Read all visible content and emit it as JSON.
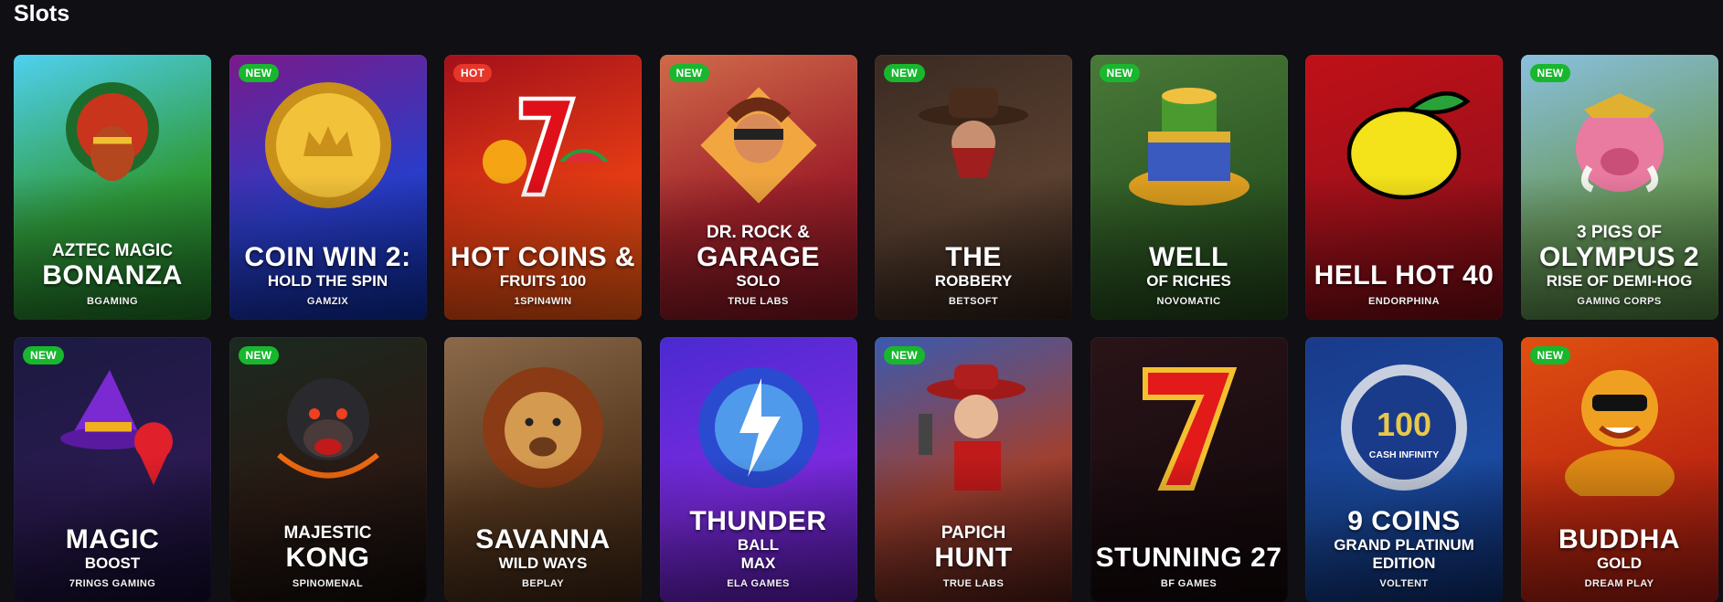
{
  "section": {
    "title": "Slots"
  },
  "games": [
    {
      "t1": "Aztec Magic",
      "t2": "Bonanza",
      "t3": "",
      "provider": "BGAMING",
      "badge": "",
      "badge_type": "",
      "bg": "linear-gradient(160deg,#4fd0f0 0%,#2f9b3a 55%,#1e6d24 100%)",
      "icon": "aztec-chief-icon"
    },
    {
      "t1": "",
      "t2": "Coin Win 2:",
      "t3": "Hold the Spin",
      "provider": "GAMZIX",
      "badge": "NEW",
      "badge_type": "new",
      "bg": "linear-gradient(160deg,#7a1a8a 0%,#2a3cc8 55%,#0a2a9a 100%)",
      "icon": "gold-coin-icon"
    },
    {
      "t1": "",
      "t2": "Hot Coins &",
      "t3": "Fruits 100",
      "provider": "1SPIN4WIN",
      "badge": "HOT",
      "badge_type": "hot",
      "bg": "linear-gradient(160deg,#a3101a 0%,#e23a14 55%,#f05a10 100%)",
      "icon": "seven-fruits-icon"
    },
    {
      "t1": "Dr. Rock &",
      "t2": "Garage",
      "t3": "Solo",
      "provider": "TRUE LABS",
      "badge": "NEW",
      "badge_type": "new",
      "bg": "linear-gradient(160deg,#d06a4a 0%,#a0222a 55%,#7a1420 100%)",
      "icon": "rocker-icon"
    },
    {
      "t1": "",
      "t2": "The",
      "t3": "Robbery",
      "provider": "BETSOFT",
      "badge": "NEW",
      "badge_type": "new",
      "bg": "linear-gradient(160deg,#3a2a22 0%,#5a4030 55%,#2a1c16 100%)",
      "icon": "cowboy-bandit-icon"
    },
    {
      "t1": "",
      "t2": "Well",
      "t3": "of Riches",
      "provider": "NOVOMATIC",
      "badge": "NEW",
      "badge_type": "new",
      "bg": "linear-gradient(160deg,#4a7a3a 0%,#2f5a24 55%,#1e3e18 100%)",
      "icon": "treasure-well-icon"
    },
    {
      "t1": "",
      "t2": "Hell Hot 40",
      "t3": "",
      "provider": "ENDORPHINA",
      "badge": "",
      "badge_type": "",
      "bg": "linear-gradient(160deg,#c01018 0%,#a0101a 55%,#700a12 100%)",
      "icon": "lemon-icon"
    },
    {
      "t1": "3 Pigs of",
      "t2": "Olympus 2",
      "t3": "Rise of Demi-Hog",
      "provider": "GAMING CORPS",
      "badge": "NEW",
      "badge_type": "new",
      "bg": "linear-gradient(160deg,#8ac0e0 0%,#6a9a60 55%,#4a7a3a 100%)",
      "icon": "pig-warrior-icon"
    },
    {
      "t1": "",
      "t2": "Magic",
      "t3": "Boost",
      "provider": "7RINGS GAMING",
      "badge": "NEW",
      "badge_type": "new",
      "bg": "linear-gradient(160deg,#1a1a40 0%,#2a1a50 55%,#120a2a 100%)",
      "icon": "wizard-hat-icon"
    },
    {
      "t1": "Majestic",
      "t2": "Kong",
      "t3": "",
      "provider": "SPINOMENAL",
      "badge": "NEW",
      "badge_type": "new",
      "bg": "linear-gradient(160deg,#1a2a20 0%,#2a1a14 55%,#120c0a 100%)",
      "icon": "gorilla-icon"
    },
    {
      "t1": "",
      "t2": "Savanna",
      "t3": "Wild Ways",
      "provider": "BEPLAY",
      "badge": "",
      "badge_type": "",
      "bg": "linear-gradient(160deg,#8a6a4a 0%,#5a3a20 55%,#3a2414 100%)",
      "icon": "lion-icon"
    },
    {
      "t1": "",
      "t2": "Thunder",
      "t3": "Ball",
      "provider": "ELA GAMES",
      "badge": "",
      "badge_type": "",
      "bg": "linear-gradient(160deg,#4a2ad0 0%,#7a2ae0 55%,#5a1ab0 100%)",
      "icon": "thunder-ball-icon",
      "t4": "Max"
    },
    {
      "t1": "Papich",
      "t2": "Hunt",
      "t3": "",
      "provider": "TRUE LABS",
      "badge": "NEW",
      "badge_type": "new",
      "bg": "linear-gradient(160deg,#3a5ab0 0%,#a04030 55%,#4a1a14 100%)",
      "icon": "cowboy-gunman-icon"
    },
    {
      "t1": "",
      "t2": "Stunning 27",
      "t3": "",
      "provider": "BF GAMES",
      "badge": "",
      "badge_type": "",
      "bg": "linear-gradient(160deg,#2a1418 0%,#1a0c10 55%,#100608 100%)",
      "icon": "seven-icon"
    },
    {
      "t1": "",
      "t2": "9 Coins",
      "t3": "Grand Platinum Edition",
      "provider": "VOLTENT",
      "badge": "",
      "badge_type": "",
      "bg": "linear-gradient(160deg,#1a3a8a 0%,#1a4aa0 55%,#0c2a6a 100%)",
      "icon": "platinum-coin-icon",
      "coin_value": "100",
      "coin_caption": "CASH INFINITY"
    },
    {
      "t1": "",
      "t2": "Buddha",
      "t3": "Gold",
      "provider": "DREAM PLAY",
      "badge": "NEW",
      "badge_type": "new",
      "bg": "linear-gradient(160deg,#e05010 0%,#c02a10 55%,#a01a10 100%)",
      "icon": "buddha-icon"
    }
  ]
}
